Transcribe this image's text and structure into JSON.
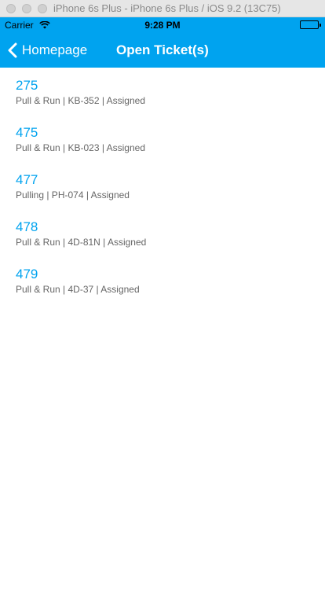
{
  "simulator": {
    "title": "iPhone 6s Plus - iPhone 6s Plus / iOS 9.2 (13C75)"
  },
  "status_bar": {
    "carrier": "Carrier",
    "time": "9:28 PM"
  },
  "navbar": {
    "back_label": "Homepage",
    "title": "Open Ticket(s)",
    "color": "#00a3ef"
  },
  "tickets": [
    {
      "id": "275",
      "detail": "Pull & Run | KB-352 | Assigned"
    },
    {
      "id": "475",
      "detail": "Pull & Run | KB-023 | Assigned"
    },
    {
      "id": "477",
      "detail": "Pulling | PH-074 | Assigned"
    },
    {
      "id": "478",
      "detail": "Pull & Run | 4D-81N | Assigned"
    },
    {
      "id": "479",
      "detail": "Pull & Run | 4D-37 | Assigned"
    }
  ]
}
